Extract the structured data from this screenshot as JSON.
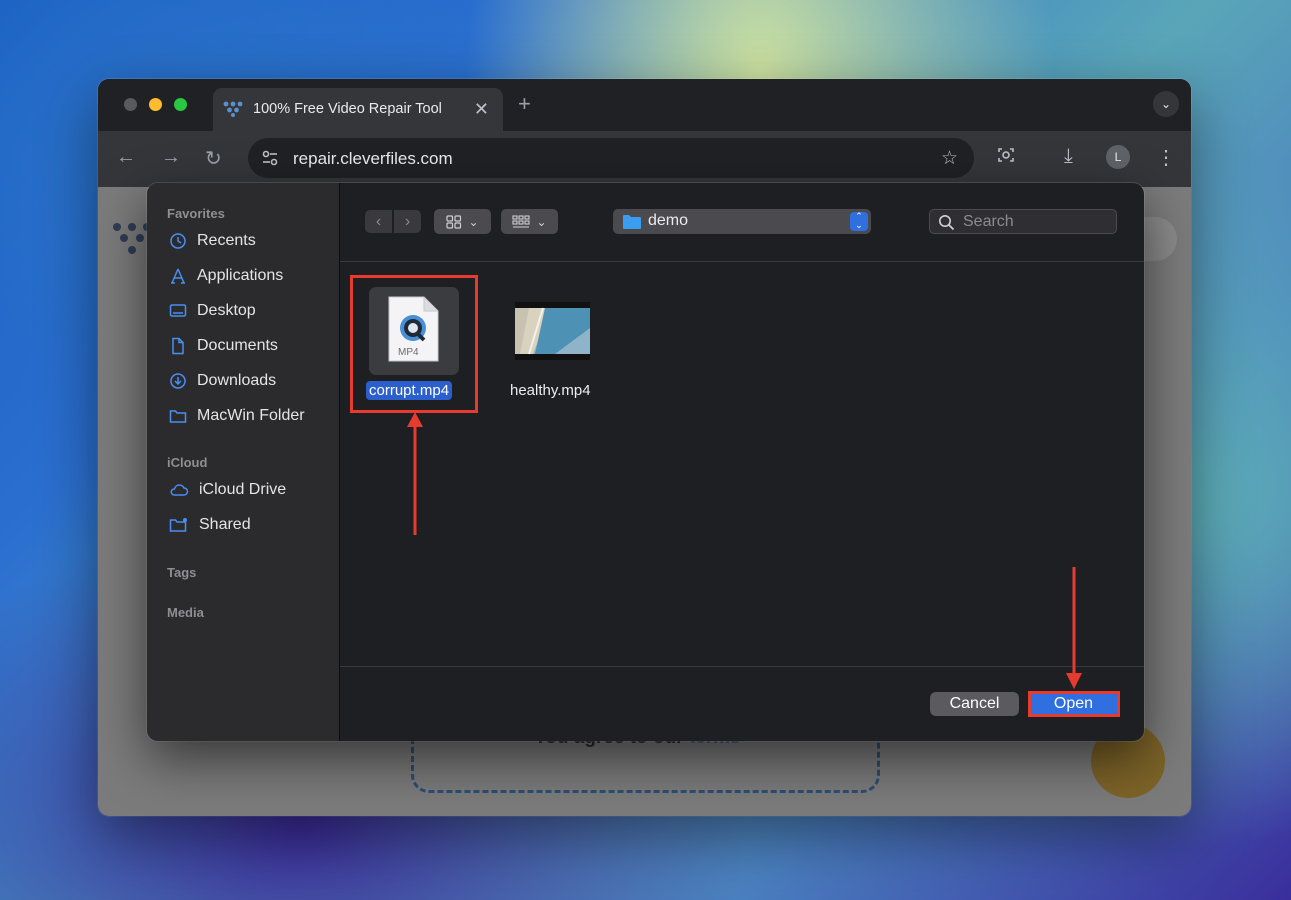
{
  "browser": {
    "tab_title": "100% Free Video Repair Tool",
    "close_glyph": "✕",
    "new_tab_glyph": "+",
    "menu_glyph": "⌄",
    "back_glyph": "←",
    "forward_glyph": "→",
    "reload_glyph": "↻",
    "url": "repair.cleverfiles.com",
    "star_glyph": "☆",
    "download_glyph": "⤓",
    "more_glyph": "⋮",
    "avatar_initial": "L"
  },
  "page": {
    "terms_text": "You agree to our ",
    "terms_link": "terms"
  },
  "dialog": {
    "sidebar": {
      "favorites_header": "Favorites",
      "favorites": [
        {
          "label": "Recents",
          "icon": "clock-icon"
        },
        {
          "label": "Applications",
          "icon": "applications-icon"
        },
        {
          "label": "Desktop",
          "icon": "desktop-icon"
        },
        {
          "label": "Documents",
          "icon": "document-icon"
        },
        {
          "label": "Downloads",
          "icon": "download-icon"
        },
        {
          "label": "MacWin Folder",
          "icon": "folder-icon"
        }
      ],
      "icloud_header": "iCloud",
      "icloud": [
        {
          "label": "iCloud Drive",
          "icon": "cloud-icon"
        },
        {
          "label": "Shared",
          "icon": "shared-folder-icon"
        }
      ],
      "tags_header": "Tags",
      "media_header": "Media"
    },
    "toolbar": {
      "back_glyph": "‹",
      "forward_glyph": "›",
      "chevron_glyph": "⌄",
      "location": "demo",
      "search_placeholder": "Search"
    },
    "files": [
      {
        "name": "corrupt.mp4",
        "type_label": "MP4",
        "selected": true
      },
      {
        "name": "healthy.mp4",
        "selected": false
      }
    ],
    "buttons": {
      "cancel": "Cancel",
      "open": "Open"
    }
  },
  "colors": {
    "accent": "#2f6fe0",
    "annotation": "#e63b2e"
  }
}
